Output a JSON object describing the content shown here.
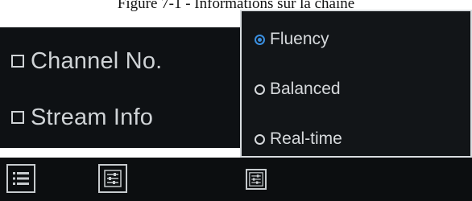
{
  "caption": "Figure 7-1 - Informations sur la chaîne",
  "overlay_panel": {
    "options": [
      {
        "label": "Channel No.",
        "checked": false
      },
      {
        "label": "Stream Info",
        "checked": false
      }
    ]
  },
  "stream_mode_menu": {
    "options": [
      {
        "label": "Fluency",
        "selected": true
      },
      {
        "label": "Balanced",
        "selected": false
      },
      {
        "label": "Real-time",
        "selected": false
      }
    ]
  },
  "toolbar": {
    "buttons": [
      {
        "icon": "list-icon"
      },
      {
        "icon": "sliders-icon"
      },
      {
        "icon": "sliders-icon"
      }
    ]
  },
  "colors": {
    "panel_background": "#0e1114",
    "text": "#cfd3d6",
    "selected_accent": "#3a8fe0"
  }
}
